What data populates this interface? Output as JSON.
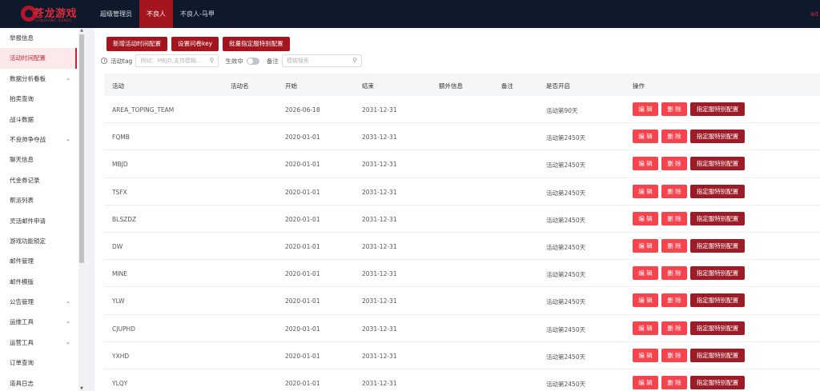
{
  "header": {
    "logo_text": "苍龙游戏",
    "logo_sub": "CANGLONG GAMES",
    "tabs": [
      {
        "label": "超级管理员"
      },
      {
        "label": "不良人"
      },
      {
        "label": "不良人-马甲"
      }
    ],
    "active_tab": 1,
    "right_text": "ad"
  },
  "sidebar": {
    "items": [
      {
        "label": "举报信息",
        "has_children": false
      },
      {
        "label": "活动时间配置",
        "has_children": false
      },
      {
        "label": "数据分析看板",
        "has_children": true
      },
      {
        "label": "拍卖查询",
        "has_children": false
      },
      {
        "label": "战斗数据",
        "has_children": false
      },
      {
        "label": "不良帅争夺战",
        "has_children": true
      },
      {
        "label": "聊天信息",
        "has_children": false
      },
      {
        "label": "代金券记录",
        "has_children": false
      },
      {
        "label": "帮派列表",
        "has_children": false
      },
      {
        "label": "灵活邮件申请",
        "has_children": false
      },
      {
        "label": "游戏功能锁定",
        "has_children": false
      },
      {
        "label": "邮件管理",
        "has_children": false
      },
      {
        "label": "邮件模版",
        "has_children": false
      },
      {
        "label": "公告管理",
        "has_children": true
      },
      {
        "label": "运维工具",
        "has_children": true
      },
      {
        "label": "运营工具",
        "has_children": true
      },
      {
        "label": "订单查询",
        "has_children": false
      },
      {
        "label": "道具日志",
        "has_children": false
      }
    ],
    "active_index": 1
  },
  "toolbar": {
    "add_label": "新增活动时间配置",
    "key_label": "设置问卷key",
    "batch_label": "批量指定服特别配置"
  },
  "filter": {
    "tag_label": "活动tag",
    "tag_placeholder": "例如：MBJD,支持模糊...",
    "active_label": "生效中",
    "note_label": "备注",
    "note_placeholder": "模糊搜索"
  },
  "table": {
    "columns": [
      "活动",
      "活动名",
      "开始",
      "结束",
      "额外信息",
      "备注",
      "是否开启",
      "操作"
    ],
    "edit_label": "编 辑",
    "delete_label": "删 除",
    "special_label": "指定服特别配置",
    "rows": [
      {
        "activity": "AREA_TOPING_TEAM",
        "name": "",
        "start": "2026-06-18",
        "end": "2031-12-31",
        "extra": "",
        "note": "",
        "open": "活动第90天"
      },
      {
        "activity": "FQMB",
        "name": "",
        "start": "2020-01-01",
        "end": "2031-12-31",
        "extra": "",
        "note": "",
        "open": "活动第2450天"
      },
      {
        "activity": "MBJD",
        "name": "",
        "start": "2020-01-01",
        "end": "2031-12-31",
        "extra": "",
        "note": "",
        "open": "活动第2450天"
      },
      {
        "activity": "TSFX",
        "name": "",
        "start": "2020-01-01",
        "end": "2031-12-31",
        "extra": "",
        "note": "",
        "open": "活动第2450天"
      },
      {
        "activity": "BLSZDZ",
        "name": "",
        "start": "2020-01-01",
        "end": "2031-12-31",
        "extra": "",
        "note": "",
        "open": "活动第2450天"
      },
      {
        "activity": "DW",
        "name": "",
        "start": "2020-01-01",
        "end": "2031-12-31",
        "extra": "",
        "note": "",
        "open": "活动第2450天"
      },
      {
        "activity": "MINE",
        "name": "",
        "start": "2020-01-01",
        "end": "2031-12-31",
        "extra": "",
        "note": "",
        "open": "活动第2450天"
      },
      {
        "activity": "YLW",
        "name": "",
        "start": "2020-01-01",
        "end": "2031-12-31",
        "extra": "",
        "note": "",
        "open": "活动第2450天"
      },
      {
        "activity": "CJUPHD",
        "name": "",
        "start": "2020-01-01",
        "end": "2031-12-31",
        "extra": "",
        "note": "",
        "open": "活动第2450天"
      },
      {
        "activity": "YXHD",
        "name": "",
        "start": "2020-01-01",
        "end": "2031-12-31",
        "extra": "",
        "note": "",
        "open": "活动第2450天"
      },
      {
        "activity": "YLQY",
        "name": "",
        "start": "2020-01-01",
        "end": "2031-12-31",
        "extra": "",
        "note": "",
        "open": "活动第2450天"
      }
    ]
  }
}
